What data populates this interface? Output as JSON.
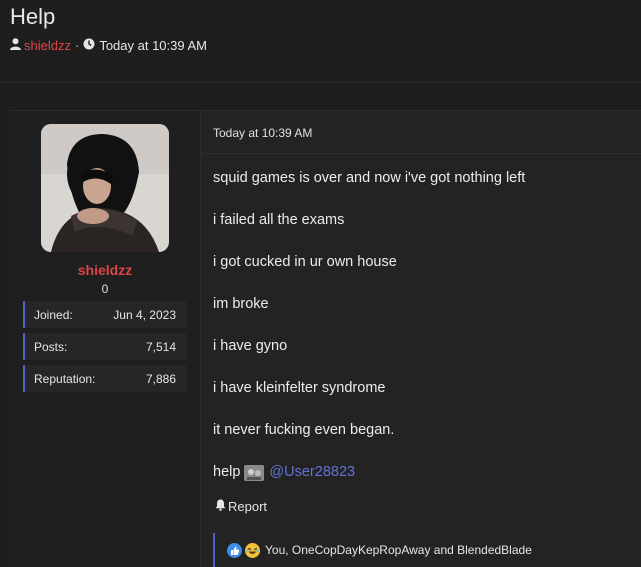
{
  "thread": {
    "title": "Help",
    "author": "shieldzz",
    "separator": "·",
    "timestamp": "Today at 10:39 AM"
  },
  "user": {
    "name": "shieldzz",
    "title": "0",
    "stats": [
      {
        "label": "Joined:",
        "value": "Jun 4, 2023"
      },
      {
        "label": "Posts:",
        "value": "7,514"
      },
      {
        "label": "Reputation:",
        "value": "7,886"
      }
    ]
  },
  "post": {
    "date": "Today at 10:39 AM",
    "lines": [
      "squid games is over and now i've got nothing left",
      "i failed all the exams",
      "i got cucked in ur own house",
      "im broke",
      "i have gyno",
      "i have kleinfelter syndrome",
      "it never fucking even began."
    ],
    "help_text": "help",
    "mention": "@User28823",
    "report_label": "Report",
    "reactions_text": "You, OneCopDayKepRopAway and BlendedBlade"
  },
  "colors": {
    "accent": "#5561c4",
    "username": "#e04545",
    "mention": "#6272d6",
    "background": "#1e1e1f"
  },
  "icons": [
    "user-icon",
    "clock-icon",
    "bell-icon",
    "like-reaction-icon",
    "laugh-reaction-icon"
  ]
}
